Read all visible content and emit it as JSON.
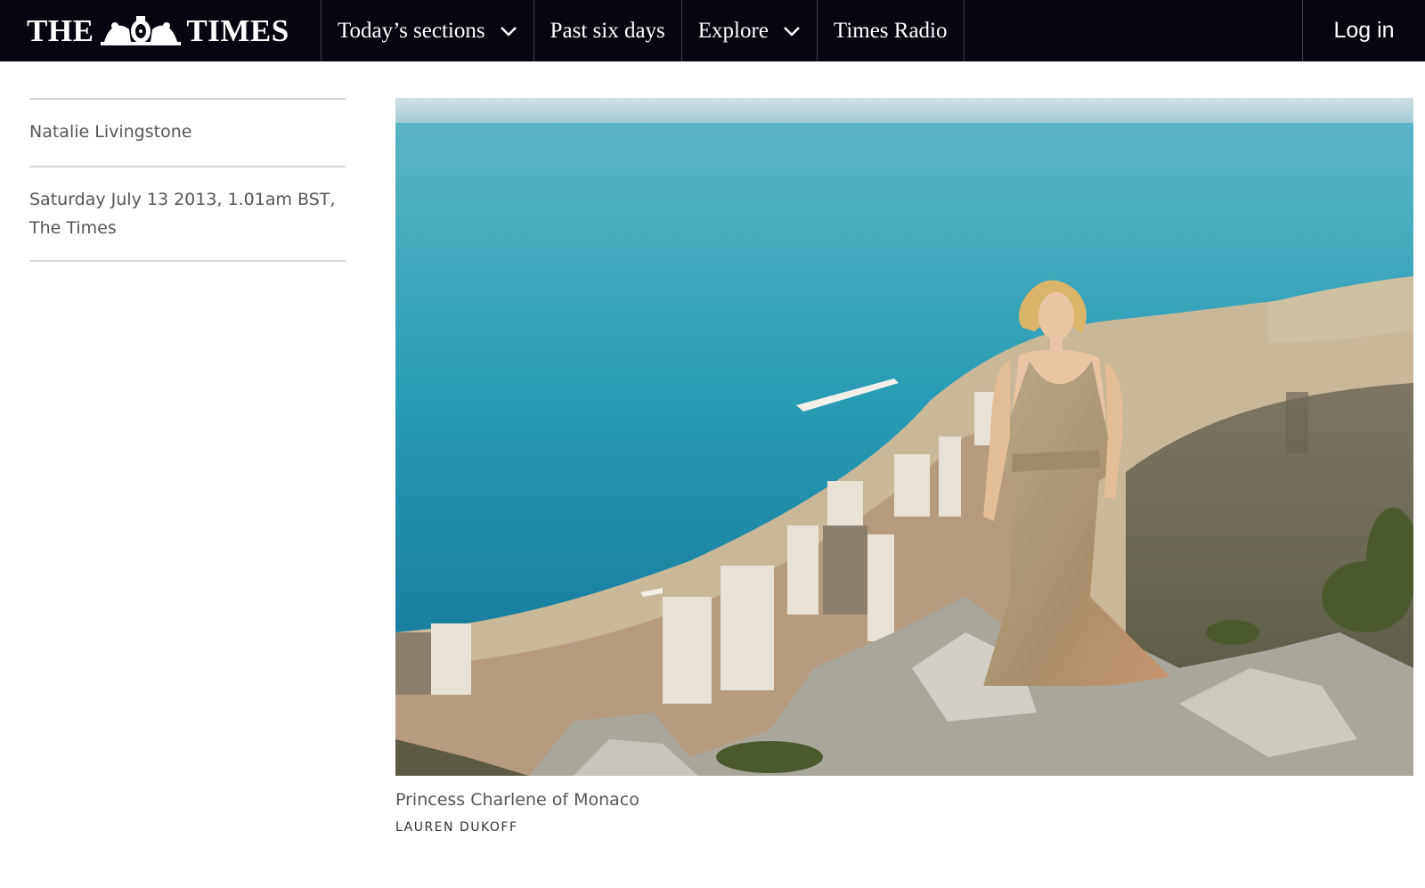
{
  "header": {
    "logo_left": "THE",
    "logo_right": "TIMES",
    "nav": [
      {
        "label": "Today’s sections",
        "has_dropdown": true
      },
      {
        "label": "Past six days",
        "has_dropdown": false
      },
      {
        "label": "Explore",
        "has_dropdown": true
      },
      {
        "label": "Times Radio",
        "has_dropdown": false
      }
    ],
    "login_label": "Log in",
    "background": "#05060f"
  },
  "article": {
    "author": "Natalie Livingstone",
    "dateline": "Saturday July 13 2013, 1.01am BST, The Times",
    "image": {
      "caption": "Princess Charlene of Monaco",
      "credit": "LAUREN DUKOFF"
    }
  }
}
